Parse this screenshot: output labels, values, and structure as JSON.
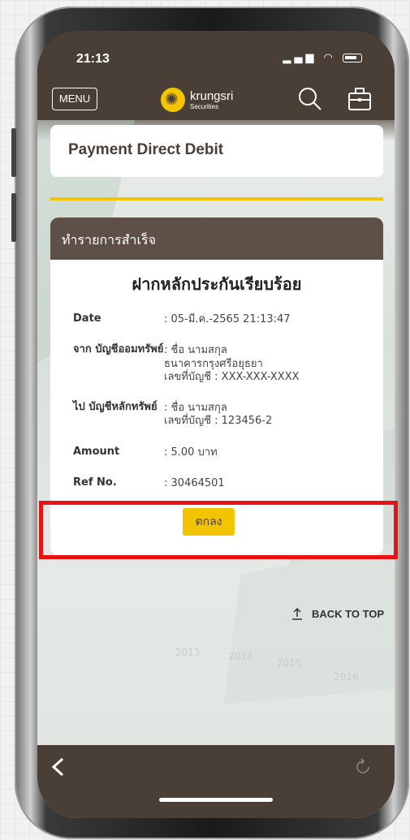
{
  "status": {
    "time": "21:13"
  },
  "nav": {
    "menu_label": "MENU",
    "logo_name": "krungsri",
    "logo_sub": "Securities"
  },
  "page": {
    "title": "Payment Direct Debit"
  },
  "card": {
    "header": "ทำรายการสำเร็จ",
    "heading": "ฝากหลักประกันเรียบร้อย",
    "rows": [
      {
        "label": "Date",
        "value": ": 05-มี.ค.-2565 21:13:47"
      },
      {
        "label": "จาก บัญชีออมทรัพย์",
        "value": ": ชื่อ นามสกุล\nธนาคารกรุงศรีอยุธยา\nเลขที่บัญชี : XXX-XXX-XXXX"
      },
      {
        "label": "ไป บัญชีหลักทรัพย์",
        "value": ": ชื่อ นามสกุล\nเลขที่บัญชี : 123456-2"
      },
      {
        "label": "Amount",
        "value": ": 5.00 บาท"
      },
      {
        "label": "Ref No.",
        "value": ": 30464501"
      }
    ],
    "ok_label": "ตกลง"
  },
  "footer": {
    "back_to_top": "BACK TO TOP"
  },
  "decor_years": [
    "2013",
    "2014",
    "2015",
    "2016"
  ],
  "colors": {
    "brand_brown": "#4a3f37",
    "brand_yellow": "#f2c500",
    "highlight_red": "#e81212"
  }
}
